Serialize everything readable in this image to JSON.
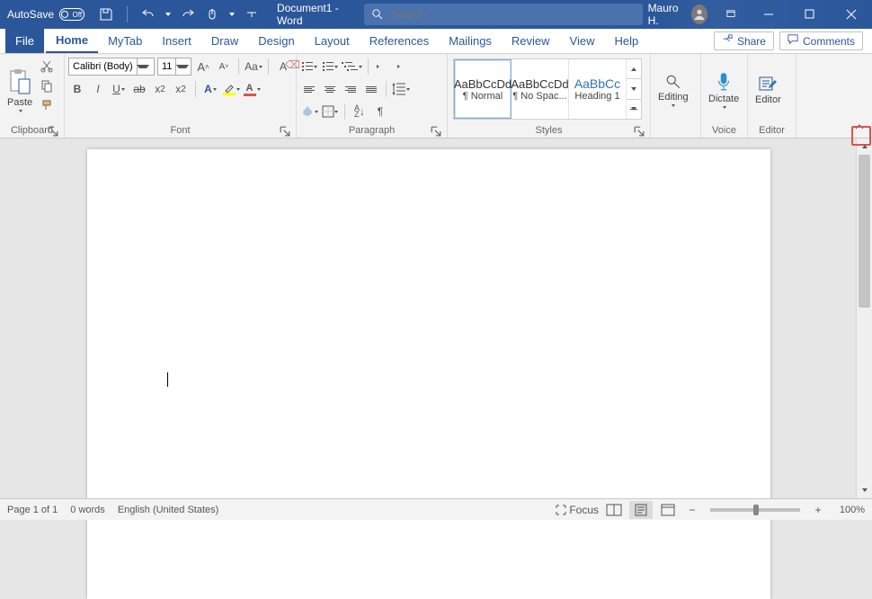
{
  "titlebar": {
    "autosave_label": "AutoSave",
    "autosave_state": "Off",
    "doc_title": "Document1 - Word",
    "search_placeholder": "Search",
    "user": "Mauro H."
  },
  "tabs": {
    "items": [
      "File",
      "Home",
      "MyTab",
      "Insert",
      "Draw",
      "Design",
      "Layout",
      "References",
      "Mailings",
      "Review",
      "View",
      "Help"
    ],
    "active": "Home",
    "share": "Share",
    "comments": "Comments"
  },
  "ribbon": {
    "clipboard": {
      "paste": "Paste",
      "label": "Clipboard"
    },
    "font": {
      "family": "Calibri (Body)",
      "size": "11",
      "label": "Font"
    },
    "paragraph": {
      "label": "Paragraph"
    },
    "styles": {
      "label": "Styles",
      "items": [
        {
          "preview": "AaBbCcDd",
          "name": "¶ Normal"
        },
        {
          "preview": "AaBbCcDd",
          "name": "¶ No Spac..."
        },
        {
          "preview": "AaBbCc",
          "name": "Heading 1"
        }
      ]
    },
    "editing": {
      "label": "Editing"
    },
    "voice": {
      "dictate": "Dictate",
      "label": "Voice"
    },
    "editor": {
      "btn": "Editor",
      "label": "Editor"
    }
  },
  "status": {
    "page": "Page 1 of 1",
    "words": "0 words",
    "lang": "English (United States)",
    "focus": "Focus",
    "zoom": "100%"
  }
}
